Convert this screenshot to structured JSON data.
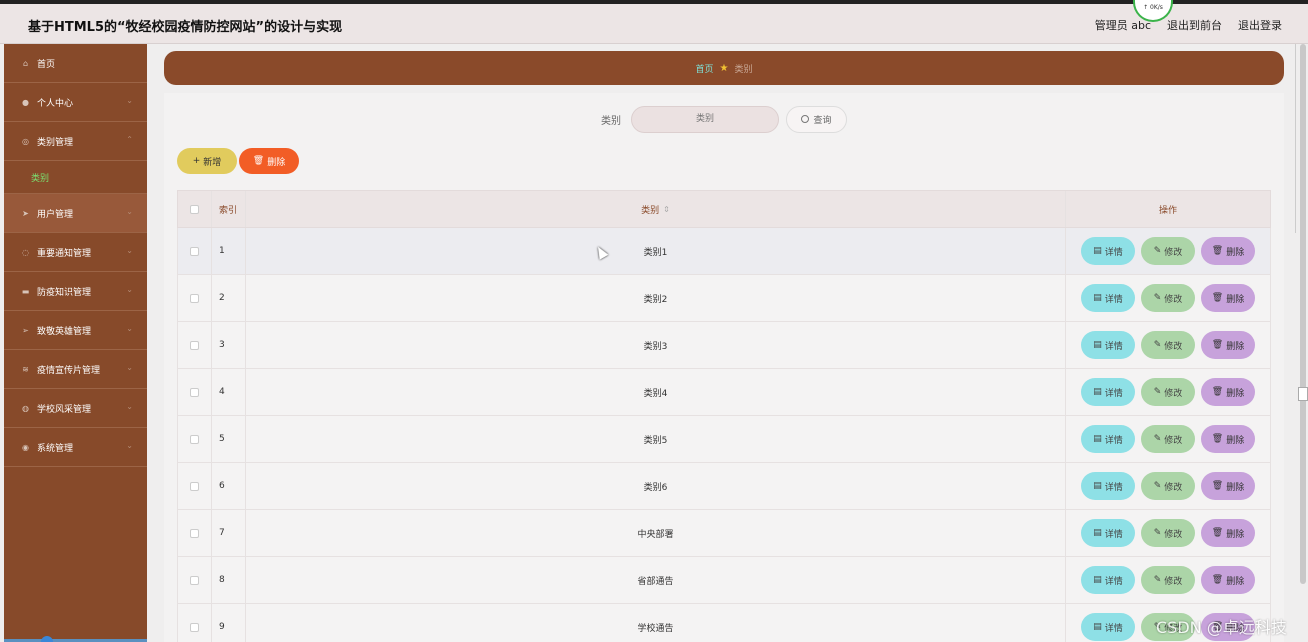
{
  "header": {
    "title": "基于HTML5的“牧经校园疫情防控网站”的设计与实现",
    "admin_label": "管理员 abc",
    "back_front": "退出到前台",
    "logout": "退出登录",
    "speed": "↑ 0K/s"
  },
  "sidebar": {
    "items": [
      {
        "label": "首页",
        "icon": "home-icon"
      },
      {
        "label": "个人中心",
        "icon": "user-icon"
      },
      {
        "label": "类别管理",
        "icon": "category-icon"
      },
      {
        "label": "用户管理",
        "icon": "users-icon"
      },
      {
        "label": "重要通知管理",
        "icon": "notice-icon"
      },
      {
        "label": "防疫知识管理",
        "icon": "knowledge-icon"
      },
      {
        "label": "致敬英雄管理",
        "icon": "send-icon"
      },
      {
        "label": "疫情宣传片管理",
        "icon": "video-icon"
      },
      {
        "label": "学校风采管理",
        "icon": "school-icon"
      },
      {
        "label": "系统管理",
        "icon": "settings-icon"
      }
    ],
    "sub_item": "类别"
  },
  "breadcrumb": {
    "home": "首页",
    "current": "类别"
  },
  "search": {
    "label": "类别",
    "placeholder": "类别",
    "button": "查询"
  },
  "actions": {
    "add": "新增",
    "delete": "删除"
  },
  "table": {
    "headers": {
      "index": "索引",
      "category": "类别",
      "operation": "操作"
    },
    "rows": [
      {
        "index": "1",
        "category": "类别1"
      },
      {
        "index": "2",
        "category": "类别2"
      },
      {
        "index": "3",
        "category": "类别3"
      },
      {
        "index": "4",
        "category": "类别4"
      },
      {
        "index": "5",
        "category": "类别5"
      },
      {
        "index": "6",
        "category": "类别6"
      },
      {
        "index": "7",
        "category": "中央部署"
      },
      {
        "index": "8",
        "category": "省部通告"
      },
      {
        "index": "9",
        "category": "学校通告"
      }
    ],
    "op_labels": {
      "detail": "详情",
      "edit": "修改",
      "delete": "删除"
    }
  },
  "watermark": "CSDN @卓远科技",
  "colors": {
    "sidebar": "#874a2a",
    "accent_green": "#7be070",
    "add": "#e1cb5d",
    "delete": "#f25d26",
    "detail": "#8ee0e6",
    "edit": "#acd5a8",
    "row_delete": "#c7a2db"
  }
}
